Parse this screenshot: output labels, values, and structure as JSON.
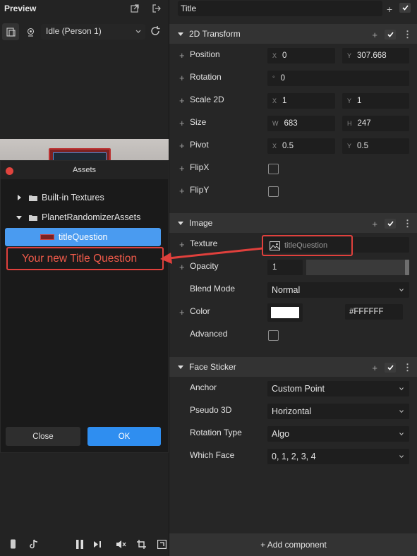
{
  "preview": {
    "title": "Preview",
    "person_select": "Idle (Person 1)"
  },
  "assets": {
    "title": "Assets",
    "tree": [
      {
        "label": "Built-in Textures"
      },
      {
        "label": "PlanetRandomizerAssets"
      }
    ],
    "selected_item": "titleQuestion",
    "callout": "Your new Title Question",
    "close_label": "Close",
    "ok_label": "OK"
  },
  "inspector": {
    "title_value": "Title",
    "transform": {
      "header": "2D Transform",
      "position": {
        "label": "Position",
        "x_axis": "X",
        "x": "0",
        "y_axis": "Y",
        "y": "307.668"
      },
      "rotation": {
        "label": "Rotation",
        "axis": "°",
        "value": "0"
      },
      "scale": {
        "label": "Scale 2D",
        "x_axis": "X",
        "x": "1",
        "y_axis": "Y",
        "y": "1"
      },
      "size": {
        "label": "Size",
        "w_axis": "W",
        "w": "683",
        "h_axis": "H",
        "h": "247"
      },
      "pivot": {
        "label": "Pivot",
        "x_axis": "X",
        "x": "0.5",
        "y_axis": "Y",
        "y": "0.5"
      },
      "flipx": {
        "label": "FlipX"
      },
      "flipy": {
        "label": "FlipY"
      }
    },
    "image": {
      "header": "Image",
      "texture": {
        "label": "Texture",
        "value": "titleQuestion"
      },
      "opacity": {
        "label": "Opacity",
        "value": "1",
        "fraction": 1.0
      },
      "blend_mode": {
        "label": "Blend Mode",
        "value": "Normal"
      },
      "color": {
        "label": "Color",
        "hex": "#FFFFFF",
        "swatch": "#FFFFFF"
      },
      "advanced": {
        "label": "Advanced"
      }
    },
    "face_sticker": {
      "header": "Face Sticker",
      "anchor": {
        "label": "Anchor",
        "value": "Custom Point"
      },
      "pseudo3d": {
        "label": "Pseudo 3D",
        "value": "Horizontal"
      },
      "rotation_type": {
        "label": "Rotation Type",
        "value": "Algo"
      },
      "which_face": {
        "label": "Which Face",
        "value": "0, 1, 2, 3, 4"
      }
    },
    "add_component": "+ Add component"
  },
  "colors": {
    "accent": "#2F8EF0",
    "selection": "#4A9BF0",
    "callout": "#E0403C",
    "close_dot": "#E0443E"
  }
}
